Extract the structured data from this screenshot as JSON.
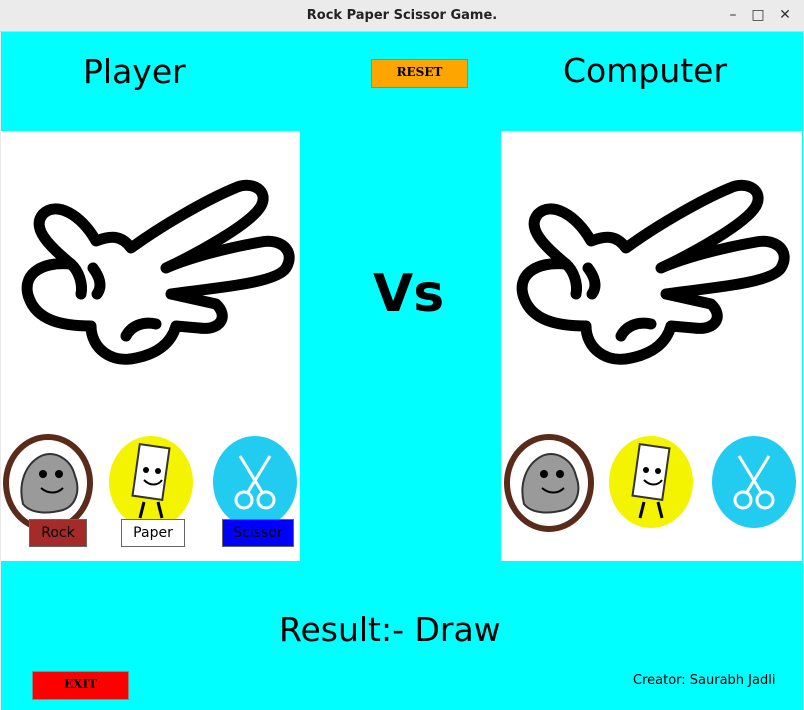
{
  "window": {
    "title": "Rock Paper Scissor Game.",
    "minimize": "–",
    "maximize": "□",
    "close": "✕"
  },
  "header": {
    "player_label": "Player",
    "computer_label": "Computer",
    "reset_label": "RESET"
  },
  "center": {
    "vs_label": "Vs"
  },
  "player": {
    "current_choice": "scissor-hand-icon"
  },
  "computer": {
    "current_choice": "scissor-hand-icon"
  },
  "choices": {
    "rock_label": "Rock",
    "paper_label": "Paper",
    "scissor_label": "Scissor"
  },
  "footer": {
    "result_text": "Result:- Draw",
    "exit_label": "EXIT",
    "creator_text": "Creator: Saurabh Jadli"
  },
  "colors": {
    "background": "#00ffff",
    "reset_button": "#ffa500",
    "exit_button": "#ff0000",
    "rock_button": "#a52a2a",
    "paper_button": "#ffffff",
    "scissor_button": "#0000ff",
    "rock_circle": "#5a2a1a",
    "paper_circle": "#f4f400",
    "scissor_circle": "#22ccf0"
  }
}
